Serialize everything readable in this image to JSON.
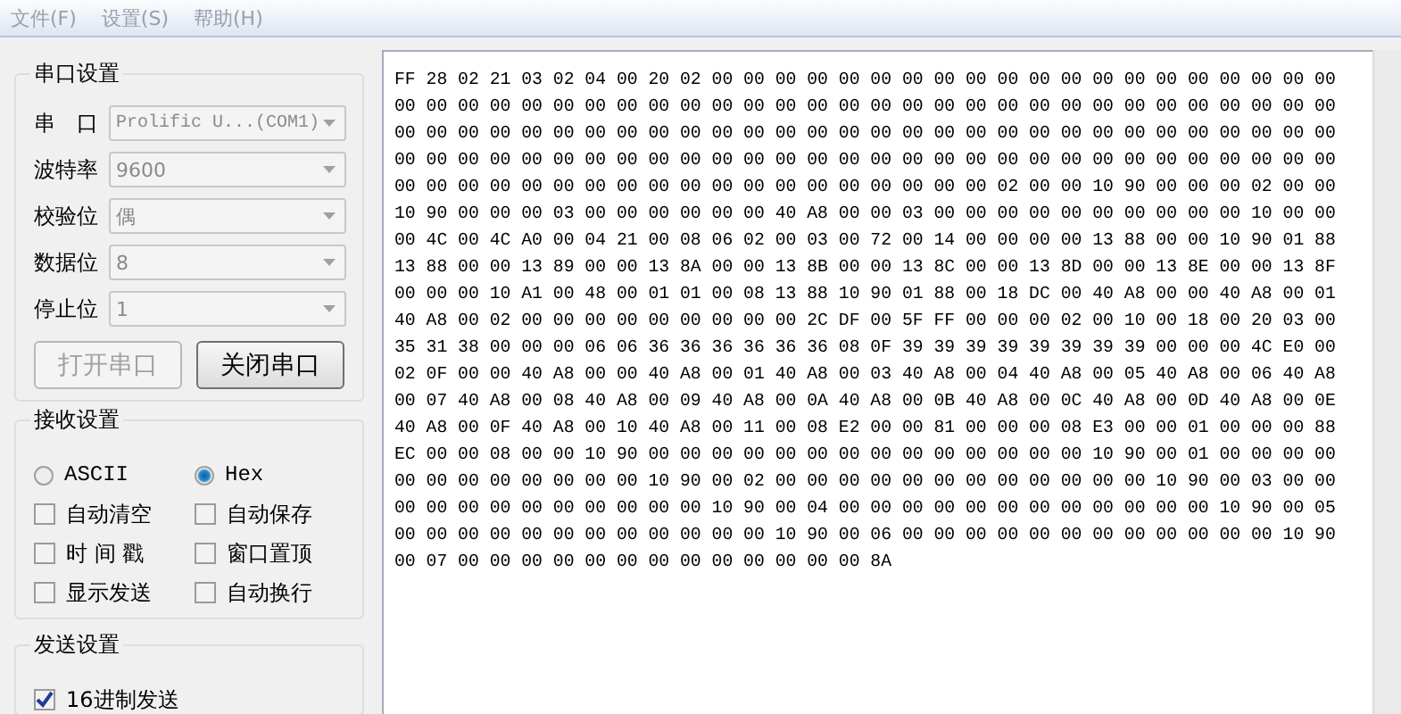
{
  "menu": [
    {
      "label": "文件(F)"
    },
    {
      "label": "设置(S)"
    },
    {
      "label": "帮助(H)"
    }
  ],
  "serial_settings": {
    "title": "串口设置",
    "fields": [
      {
        "label": "串　口",
        "value": "Prolific U...(COM1)",
        "kind": "mono"
      },
      {
        "label": "波特率",
        "value": "9600",
        "kind": "plain"
      },
      {
        "label": "校验位",
        "value": "偶",
        "kind": "plain"
      },
      {
        "label": "数据位",
        "value": "8",
        "kind": "plain"
      },
      {
        "label": "停止位",
        "value": "1",
        "kind": "plain"
      }
    ],
    "buttons": [
      {
        "label": "打开串口",
        "disabled": true
      },
      {
        "label": "关闭串口",
        "disabled": false
      }
    ]
  },
  "receive_settings": {
    "title": "接收设置",
    "modes": [
      {
        "label": "ASCII",
        "selected": false
      },
      {
        "label": "Hex",
        "selected": true
      }
    ],
    "options": [
      {
        "label": "自动清空",
        "checked": false
      },
      {
        "label": "自动保存",
        "checked": false
      },
      {
        "label": "时 间 戳",
        "checked": false
      },
      {
        "label": "窗口置顶",
        "checked": false
      },
      {
        "label": "显示发送",
        "checked": false
      },
      {
        "label": "自动换行",
        "checked": false
      }
    ]
  },
  "send_settings": {
    "title": "发送设置",
    "options": [
      {
        "label": "16进制发送",
        "checked": true
      }
    ]
  },
  "receive_lines": [
    "FF 28 02 21 03 02 04 00 20 02 00 00 00 00 00 00 00 00 00 00 00 00 00 00 00 00 00 00 00 00",
    "00 00 00 00 00 00 00 00 00 00 00 00 00 00 00 00 00 00 00 00 00 00 00 00 00 00 00 00 00 00",
    "00 00 00 00 00 00 00 00 00 00 00 00 00 00 00 00 00 00 00 00 00 00 00 00 00 00 00 00 00 00",
    "00 00 00 00 00 00 00 00 00 00 00 00 00 00 00 00 00 00 00 00 00 00 00 00 00 00 00 00 00 00",
    "00 00 00 00 00 00 00 00 00 00 00 00 00 00 00 00 00 00 00 02 00 00 10 90 00 00 00 02 00 00",
    "10 90 00 00 00 03 00 00 00 00 00 00 40 A8 00 00 03 00 00 00 00 00 00 00 00 00 00 10 00 00",
    "00 4C 00 4C A0 00 04 21 00 08 06 02 00 03 00 72 00 14 00 00 00 00 13 88 00 00 10 90 01 88",
    "13 88 00 00 13 89 00 00 13 8A 00 00 13 8B 00 00 13 8C 00 00 13 8D 00 00 13 8E 00 00 13 8F",
    "00 00 00 10 A1 00 48 00 01 01 00 08 13 88 10 90 01 88 00 18 DC 00 40 A8 00 00 40 A8 00 01",
    "40 A8 00 02 00 00 00 00 00 00 00 00 00 2C DF 00 5F FF 00 00 00 02 00 10 00 18 00 20 03 00",
    "35 31 38 00 00 00 06 06 36 36 36 36 36 36 08 0F 39 39 39 39 39 39 39 39 00 00 00 4C E0 00",
    "02 0F 00 00 40 A8 00 00 40 A8 00 01 40 A8 00 03 40 A8 00 04 40 A8 00 05 40 A8 00 06 40 A8",
    "00 07 40 A8 00 08 40 A8 00 09 40 A8 00 0A 40 A8 00 0B 40 A8 00 0C 40 A8 00 0D 40 A8 00 0E",
    "40 A8 00 0F 40 A8 00 10 40 A8 00 11 00 08 E2 00 00 81 00 00 00 08 E3 00 00 01 00 00 00 88",
    "EC 00 00 08 00 00 10 90 00 00 00 00 00 00 00 00 00 00 00 00 00 00 10 90 00 01 00 00 00 00",
    "00 00 00 00 00 00 00 00 10 90 00 02 00 00 00 00 00 00 00 00 00 00 00 00 10 90 00 03 00 00",
    "00 00 00 00 00 00 00 00 00 00 10 90 00 04 00 00 00 00 00 00 00 00 00 00 00 00 10 90 00 05",
    "00 00 00 00 00 00 00 00 00 00 00 00 10 90 00 06 00 00 00 00 00 00 00 00 00 00 00 00 10 90",
    "00 07 00 00 00 00 00 00 00 00 00 00 00 00 00 8A"
  ]
}
